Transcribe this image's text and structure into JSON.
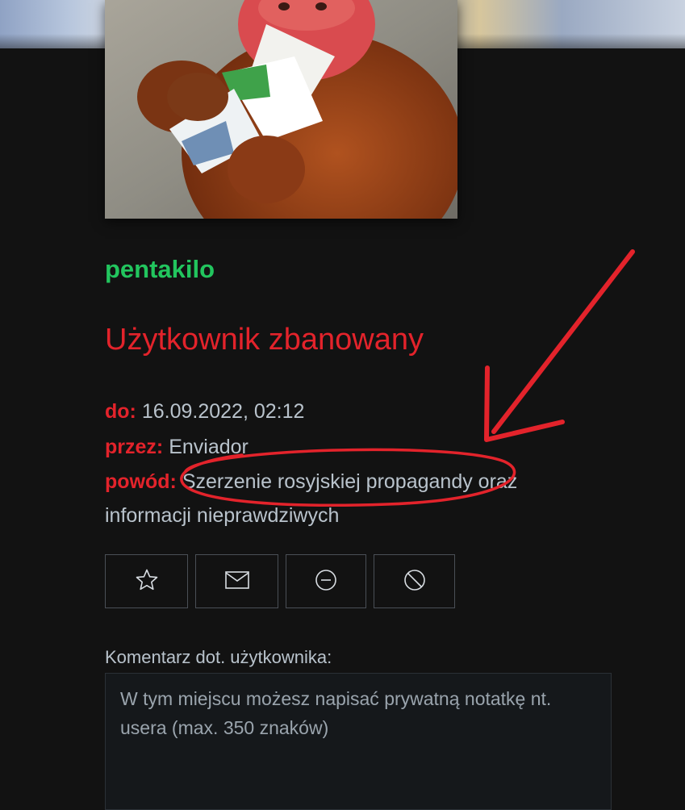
{
  "profile": {
    "username": "pentakilo"
  },
  "ban": {
    "title": "Użytkownik zbanowany",
    "until_label": "do:",
    "until_value": "16.09.2022, 02:12",
    "by_label": "przez:",
    "by_value": "Enviador",
    "reason_label": "powód:",
    "reason_value": "Szerzenie rosyjskiej propagandy oraz informacji nieprawdziwych"
  },
  "actions": [
    {
      "icon": "star-icon"
    },
    {
      "icon": "envelope-icon"
    },
    {
      "icon": "minus-circle-icon"
    },
    {
      "icon": "block-icon"
    }
  ],
  "comment": {
    "label": "Komentarz dot. użytkownika:",
    "placeholder": "W tym miejscu możesz napisać prywatną notatkę nt. usera (max. 350 znaków)",
    "value": ""
  },
  "colors": {
    "background": "#121212",
    "username": "#22c55e",
    "ban_accent": "#e3232b",
    "text": "#b9c3cc",
    "annotation": "#e3232b"
  }
}
